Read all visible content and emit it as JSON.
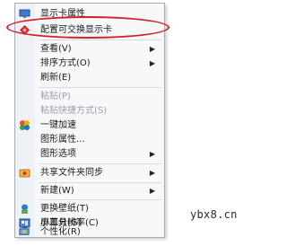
{
  "menu": {
    "items": [
      {
        "label": "显示卡属性",
        "enabled": true,
        "icon": "display-properties-icon"
      },
      {
        "label": "配置可交换显示卡",
        "enabled": true,
        "icon": "amd-diamond-icon"
      },
      {
        "label": "查看(V)",
        "enabled": true,
        "submenu": true
      },
      {
        "label": "排序方式(O)",
        "enabled": true,
        "submenu": true
      },
      {
        "label": "刷新(E)",
        "enabled": true
      },
      {
        "label": "粘贴(P)",
        "enabled": false
      },
      {
        "label": "粘贴快捷方式(S)",
        "enabled": false
      },
      {
        "label": "一键加速",
        "enabled": true,
        "icon": "speedup-icon"
      },
      {
        "label": "图形属性...",
        "enabled": true
      },
      {
        "label": "图形选项",
        "enabled": true,
        "submenu": true
      },
      {
        "label": "共享文件夹同步",
        "enabled": true,
        "submenu": true,
        "icon": "shared-folder-sync-icon"
      },
      {
        "label": "新建(W)",
        "enabled": true,
        "submenu": true
      },
      {
        "label": "更换壁纸(T)",
        "enabled": true,
        "icon": "wallpaper-icon"
      },
      {
        "label": "屏幕分辨率(C)",
        "enabled": true,
        "icon": "screen-resolution-icon"
      },
      {
        "label": "小工具(G)",
        "enabled": true,
        "icon": "gadgets-icon"
      },
      {
        "label": "个性化(R)",
        "enabled": true,
        "icon": "personalize-icon"
      }
    ]
  },
  "highlight_color": "#d42028",
  "watermark": "ybx8.cn"
}
